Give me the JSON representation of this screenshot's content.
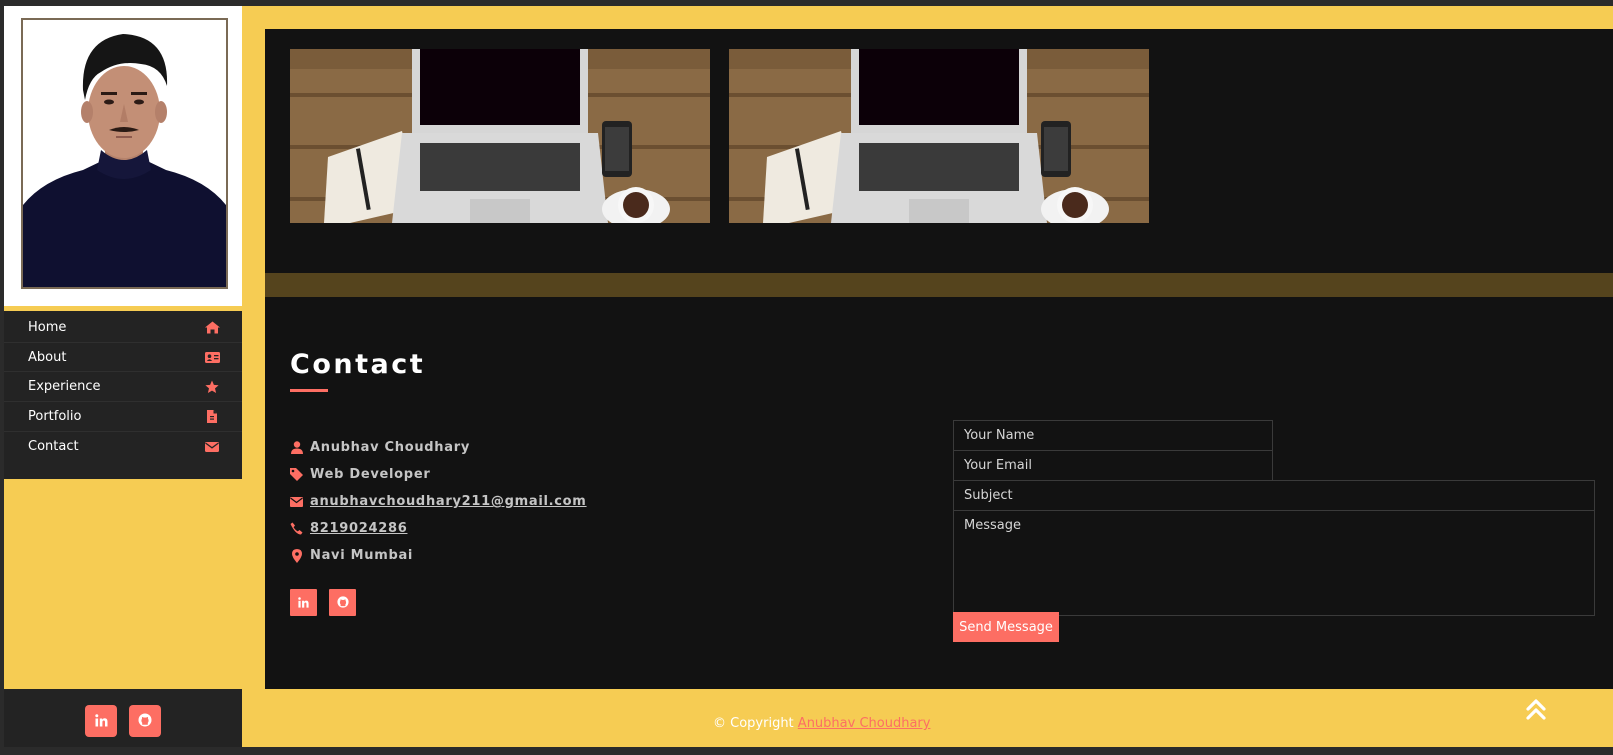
{
  "colors": {
    "accent": "#fd6e63",
    "yellow": "#f6cc53",
    "panel": "#121212",
    "nav_bg": "#232323"
  },
  "sidebar": {
    "profile_photo_icon": "person-photo",
    "nav": [
      {
        "label": "Home",
        "icon": "home-icon"
      },
      {
        "label": "About",
        "icon": "id-card-icon"
      },
      {
        "label": "Experience",
        "icon": "star-icon"
      },
      {
        "label": "Portfolio",
        "icon": "file-icon"
      },
      {
        "label": "Contact",
        "icon": "envelope-icon"
      }
    ],
    "social": [
      {
        "icon": "linkedin-icon"
      },
      {
        "icon": "github-icon"
      }
    ]
  },
  "portfolio": {
    "thumbnails": [
      {
        "icon": "laptop-desk-photo"
      },
      {
        "icon": "laptop-desk-photo"
      }
    ]
  },
  "contact": {
    "title": "Contact",
    "info": [
      {
        "icon": "user-icon",
        "text": "Anubhav Choudhary"
      },
      {
        "icon": "tag-icon",
        "text": "Web Developer"
      },
      {
        "icon": "envelope-icon",
        "text": "anubhavchoudhary211@gmail.com"
      },
      {
        "icon": "phone-icon",
        "text": "8219024286"
      },
      {
        "icon": "map-marker-icon",
        "text": "Navi Mumbai"
      }
    ],
    "form": {
      "name_placeholder": "Your Name",
      "email_placeholder": "Your Email",
      "subject_placeholder": "Subject",
      "message_placeholder": "Message",
      "send_label": "Send Message"
    }
  },
  "footer": {
    "copyright_prefix": "© Copyright ",
    "copyright_name": "Anubhav Choudhary",
    "back_to_top_icon": "double-chevron-up-icon"
  }
}
